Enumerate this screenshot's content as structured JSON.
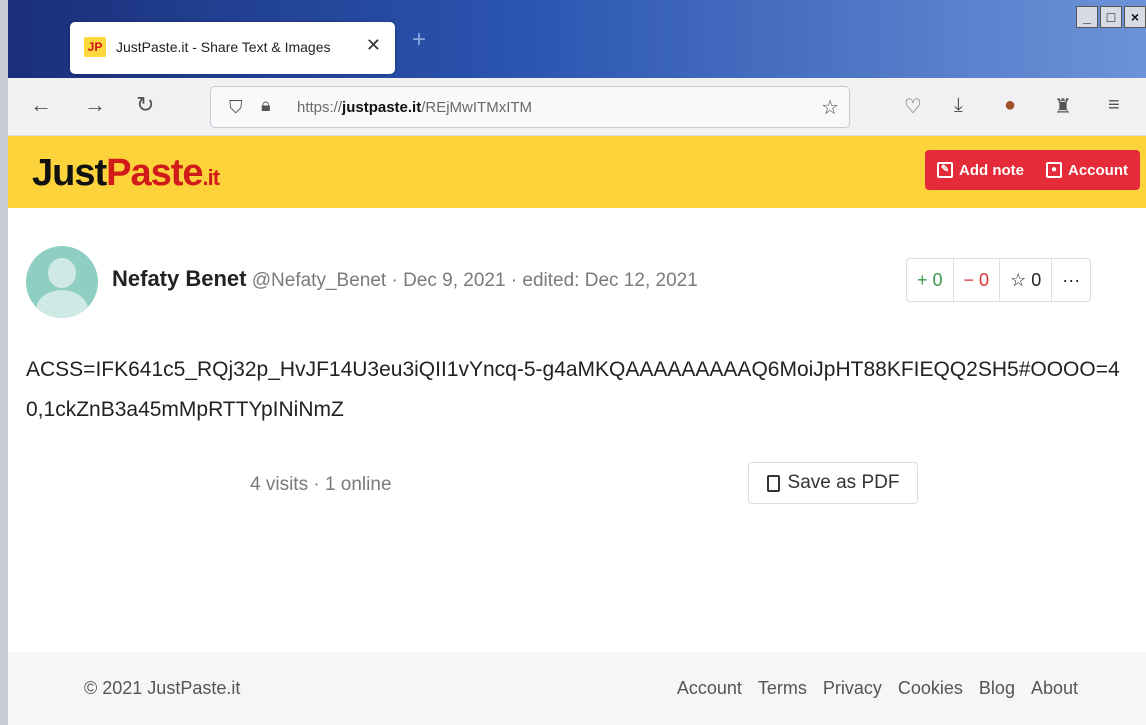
{
  "browser": {
    "tab_title": "JustPaste.it - Share Text & Images",
    "favicon_text": "JP",
    "close_glyph": "✕",
    "new_tab_glyph": "+",
    "window_controls": [
      "_",
      "□",
      "×"
    ],
    "url_prefix": "https://",
    "url_host": "justpaste.it",
    "url_path": "/REjMwITMxITM"
  },
  "site": {
    "logo_just": "Just",
    "logo_paste": "Paste",
    "logo_it": ".it",
    "add_note_label": "Add note",
    "account_label": "Account"
  },
  "post": {
    "author_name": "Nefaty Benet",
    "meta": "@Nefaty_Benet · Dec 9, 2021 · edited: Dec 12, 2021",
    "votes_up": "+ 0",
    "votes_down": "− 0",
    "favorites": "☆ 0",
    "more": "···",
    "content": "ACSS=IFK641c5_RQj32p_HvJF14U3eu3iQII1vYncq-5-g4aMKQAAAAAAAAAQ6MoiJpHT88KFIEQQ2SH5#OOOO=40,1ckZnB3a45mMpRTTYpINiNmZ",
    "stats": "4 visits · 1 online",
    "save_pdf_label": "Save as PDF"
  },
  "footer": {
    "copyright": "© 2021 JustPaste.it",
    "links": [
      "Account",
      "Terms",
      "Privacy",
      "Cookies",
      "Blog",
      "About"
    ]
  },
  "colors": {
    "header_yellow": "#fdd33b",
    "accent_red": "#e52a39",
    "logo_red": "#d11a1a",
    "vote_green": "#3a9a4a"
  }
}
